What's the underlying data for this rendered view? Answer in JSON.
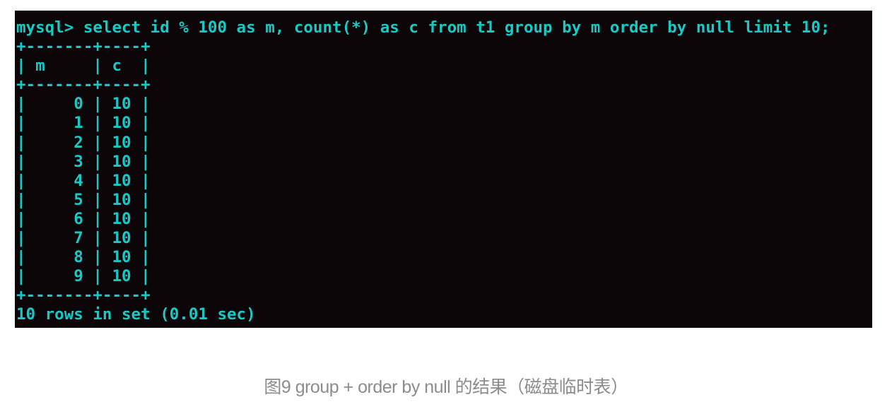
{
  "terminal": {
    "lines": [
      "mysql> select id % 100 as m, count(*) as c from t1 group by m order by null limit 10;",
      "+-------+----+",
      "| m     | c  |",
      "+-------+----+",
      "|     0 | 10 |",
      "|     1 | 10 |",
      "|     2 | 10 |",
      "|     3 | 10 |",
      "|     4 | 10 |",
      "|     5 | 10 |",
      "|     6 | 10 |",
      "|     7 | 10 |",
      "|     8 | 10 |",
      "|     9 | 10 |",
      "+-------+----+",
      "10 rows in set (0.01 sec)"
    ],
    "text_color": "#19c9c6",
    "background": "#0c0609"
  },
  "caption": "图9 group + order by null 的结果（磁盘临时表）"
}
